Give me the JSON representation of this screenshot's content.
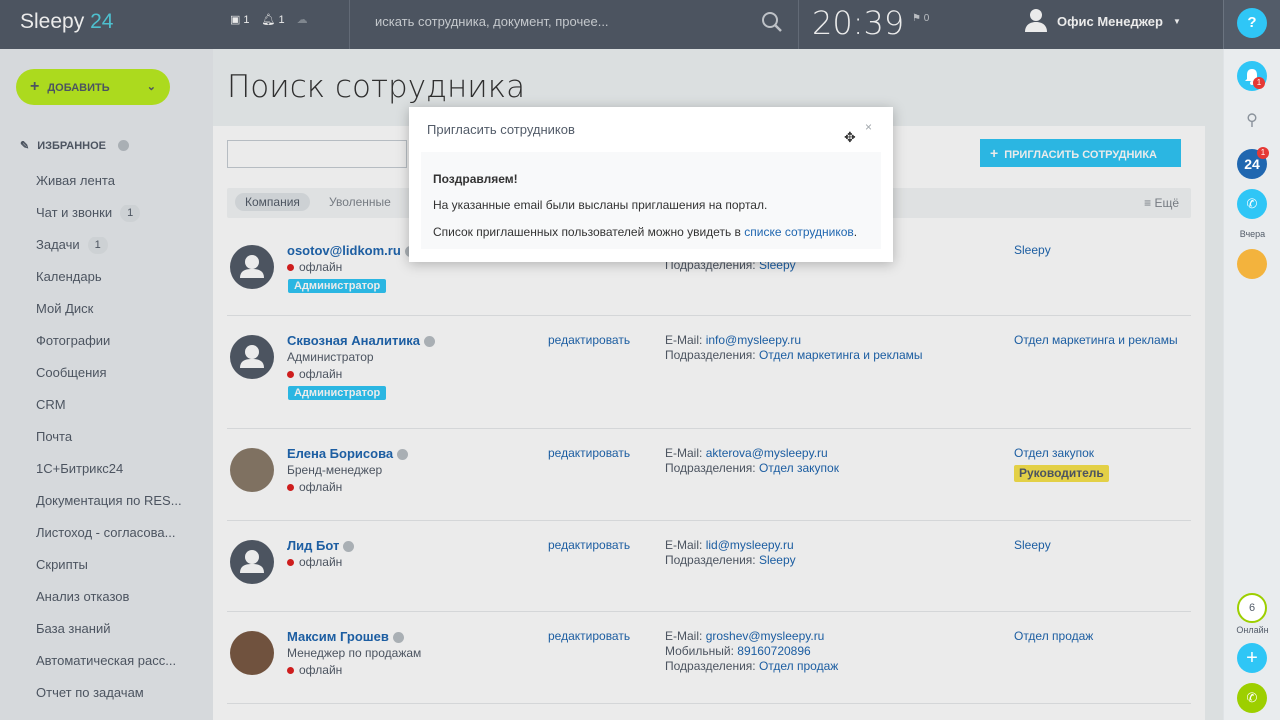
{
  "topbar": {
    "logo": "Sleepy",
    "logo_suffix": "24",
    "chat_count": "1",
    "notify_count": "1",
    "search_placeholder": "искать сотрудника, документ, прочее...",
    "clock": "20:39",
    "flag_count": "0",
    "user_name": "Офис Менеджер",
    "help": "?"
  },
  "add_button": "ДОБАВИТЬ",
  "favorites": "ИЗБРАННОЕ",
  "nav": [
    {
      "label": "Живая лента",
      "badge": ""
    },
    {
      "label": "Чат и звонки",
      "badge": "1"
    },
    {
      "label": "Задачи",
      "badge": "1"
    },
    {
      "label": "Календарь",
      "badge": ""
    },
    {
      "label": "Мой Диск",
      "badge": ""
    },
    {
      "label": "Фотографии",
      "badge": ""
    },
    {
      "label": "Сообщения",
      "badge": ""
    },
    {
      "label": "CRM",
      "badge": ""
    },
    {
      "label": "Почта",
      "badge": ""
    },
    {
      "label": "1С+Битрикс24",
      "badge": ""
    },
    {
      "label": "Документация по RES...",
      "badge": ""
    },
    {
      "label": "Листоход - согласова...",
      "badge": ""
    },
    {
      "label": "Скрипты",
      "badge": ""
    },
    {
      "label": "Анализ отказов",
      "badge": ""
    },
    {
      "label": "База знаний",
      "badge": ""
    },
    {
      "label": "Автоматическая расс...",
      "badge": ""
    },
    {
      "label": "Отчет по задачам",
      "badge": ""
    }
  ],
  "page_title": "Поиск сотрудника",
  "invite_button": "ПРИГЛАСИТЬ СОТРУДНИКА",
  "tabs": {
    "company": "Компания",
    "fired": "Уволенные",
    "more": "Ещё"
  },
  "employees": [
    {
      "name": "osotov@lidkom.ru",
      "position": "",
      "status": "офлайн",
      "admin": "Администратор",
      "edit": "",
      "email_label": "",
      "email": "",
      "mobile_label": "",
      "mobile": "",
      "dept_label": "Подразделения:",
      "dept": "Sleepy",
      "dept_right": "Sleepy",
      "head": ""
    },
    {
      "name": "Сквозная Аналитика",
      "position": "Администратор",
      "status": "офлайн",
      "admin": "Администратор",
      "edit": "редактировать",
      "email_label": "E-Mail:",
      "email": "info@mysleepy.ru",
      "mobile_label": "",
      "mobile": "",
      "dept_label": "Подразделения:",
      "dept": "Отдел маркетинга и рекламы",
      "dept_right": "Отдел маркетинга и рекламы",
      "head": ""
    },
    {
      "name": "Елена Борисова",
      "position": "Бренд-менеджер",
      "status": "офлайн",
      "admin": "",
      "edit": "редактировать",
      "email_label": "E-Mail:",
      "email": "akterova@mysleepy.ru",
      "mobile_label": "",
      "mobile": "",
      "dept_label": "Подразделения:",
      "dept": "Отдел закупок",
      "dept_right": "Отдел закупок",
      "head": "Руководитель"
    },
    {
      "name": "Лид Бот",
      "position": "",
      "status": "офлайн",
      "admin": "",
      "edit": "редактировать",
      "email_label": "E-Mail:",
      "email": "lid@mysleepy.ru",
      "mobile_label": "",
      "mobile": "",
      "dept_label": "Подразделения:",
      "dept": "Sleepy",
      "dept_right": "Sleepy",
      "head": ""
    },
    {
      "name": "Максим Грошев",
      "position": "Менеджер по продажам",
      "status": "офлайн",
      "admin": "",
      "edit": "редактировать",
      "email_label": "E-Mail:",
      "email": "groshev@mysleepy.ru",
      "mobile_label": "Мобильный:",
      "mobile": "89160720896",
      "dept_label": "Подразделения:",
      "dept": "Отдел продаж",
      "dept_right": "Отдел продаж",
      "head": ""
    }
  ],
  "rightbar": {
    "yesterday": "Вчера",
    "online_count": "6",
    "online": "Онлайн",
    "badge24": "24",
    "notif_badge": "1"
  },
  "modal": {
    "title": "Пригласить сотрудников",
    "close": "×",
    "congrats": "Поздравляем!",
    "line1": "На указанные email были высланы приглашения на портал.",
    "line2_prefix": "Список приглашенных пользователей можно увидеть в ",
    "line2_link": "списке сотрудников",
    "line2_suffix": "."
  },
  "colors": {
    "topbar": "#535c69",
    "accent": "#2fc6f6",
    "add": "#bbed21",
    "link": "#2067b0"
  }
}
